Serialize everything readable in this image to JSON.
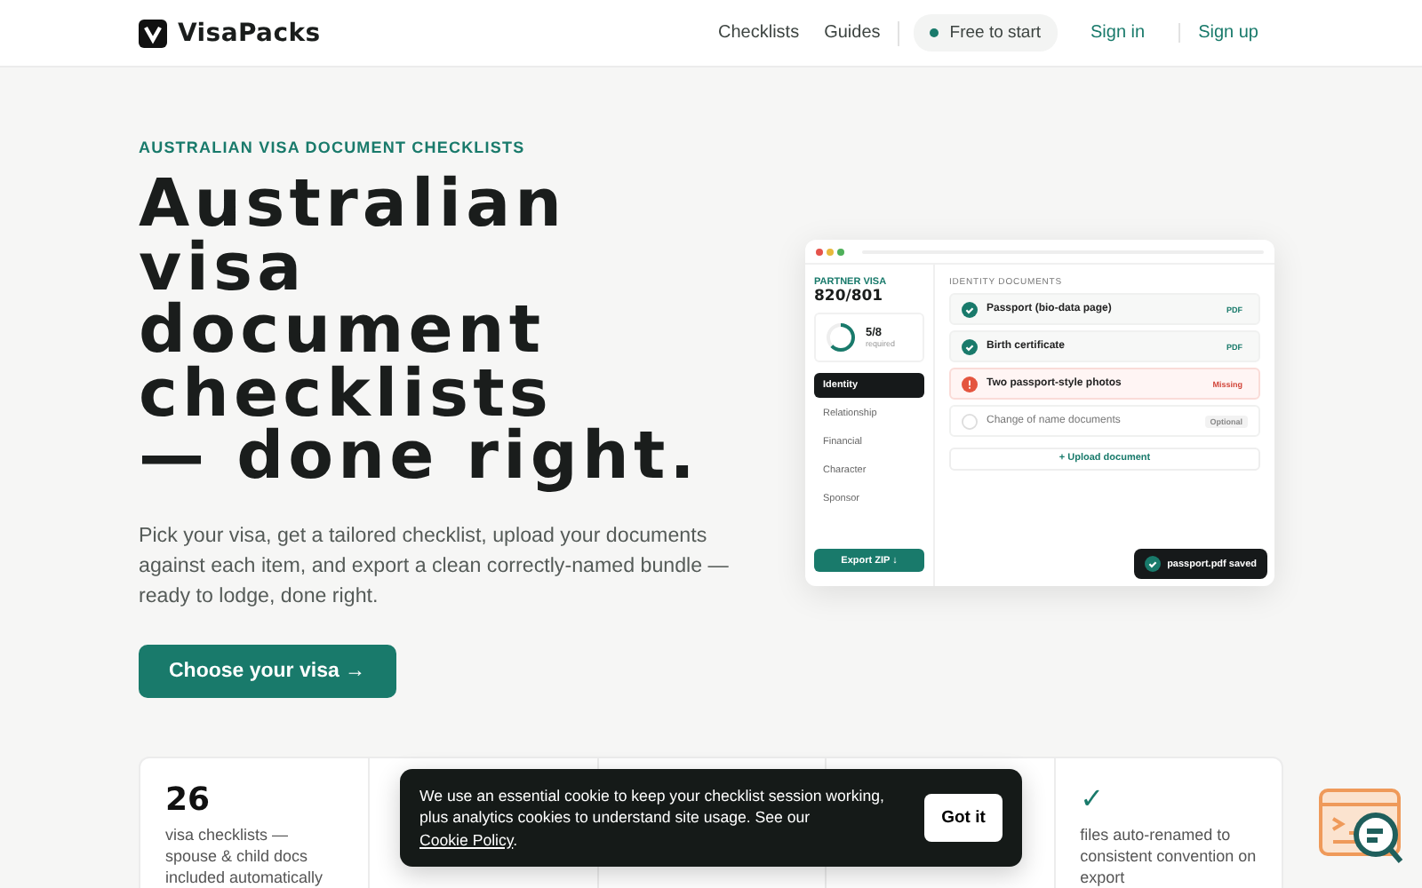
{
  "nav": {
    "logo": "VisaPacks",
    "links": [
      "Checklists",
      "Guides"
    ],
    "badge": "Free to start",
    "actions": [
      "Sign in",
      "Sign up"
    ]
  },
  "hero": {
    "eyebrow": "AUSTRALIAN VISA DOCUMENT CHECKLISTS",
    "title_lines": [
      "Australian",
      "visa",
      "document",
      "checklists",
      "— done right."
    ],
    "lead": "Pick your visa, get a tailored checklist, upload your documents against each item, and export a clean correctly-named bundle — ready to lodge, done right.",
    "cta": "Choose your visa →"
  },
  "mockup": {
    "visa_label": "PARTNER VISA",
    "visa_code": "820/801",
    "progress": {
      "count": "5/8",
      "caption": "required"
    },
    "sections": [
      {
        "label": "Identity",
        "selected": true
      },
      {
        "label": "Relationship",
        "selected": false
      },
      {
        "label": "Financial",
        "selected": false
      },
      {
        "label": "Character",
        "selected": false
      },
      {
        "label": "Sponsor",
        "selected": false
      }
    ],
    "export": "Export ZIP ↓",
    "heading": "IDENTITY DOCUMENTS",
    "documents": [
      {
        "name": "Passport (bio-data page)",
        "kind": "done",
        "tag": "PDF"
      },
      {
        "name": "Birth certificate",
        "kind": "done",
        "tag": "PDF"
      },
      {
        "name": "Two passport-style photos",
        "kind": "missing",
        "tag": "Missing"
      },
      {
        "name": "Change of name documents",
        "kind": "optional",
        "tag": "Optional"
      }
    ],
    "upload": "+ Upload document",
    "toast": "passport.pdf saved"
  },
  "stats": [
    {
      "value": "26",
      "kind": "number",
      "text": "visa checklists — spouse & child docs included automatically"
    },
    {
      "kind": "hidden"
    },
    {
      "kind": "hidden"
    },
    {
      "kind": "hidden"
    },
    {
      "value": "✓",
      "kind": "check",
      "text": "files auto-renamed to consistent convention on export"
    }
  ],
  "cookie": {
    "text_before": "We use an essential cookie to keep your checklist session working, plus analytics cookies to understand site usage. See our ",
    "link": "Cookie Policy",
    "text_after": ".",
    "button": "Got it"
  }
}
